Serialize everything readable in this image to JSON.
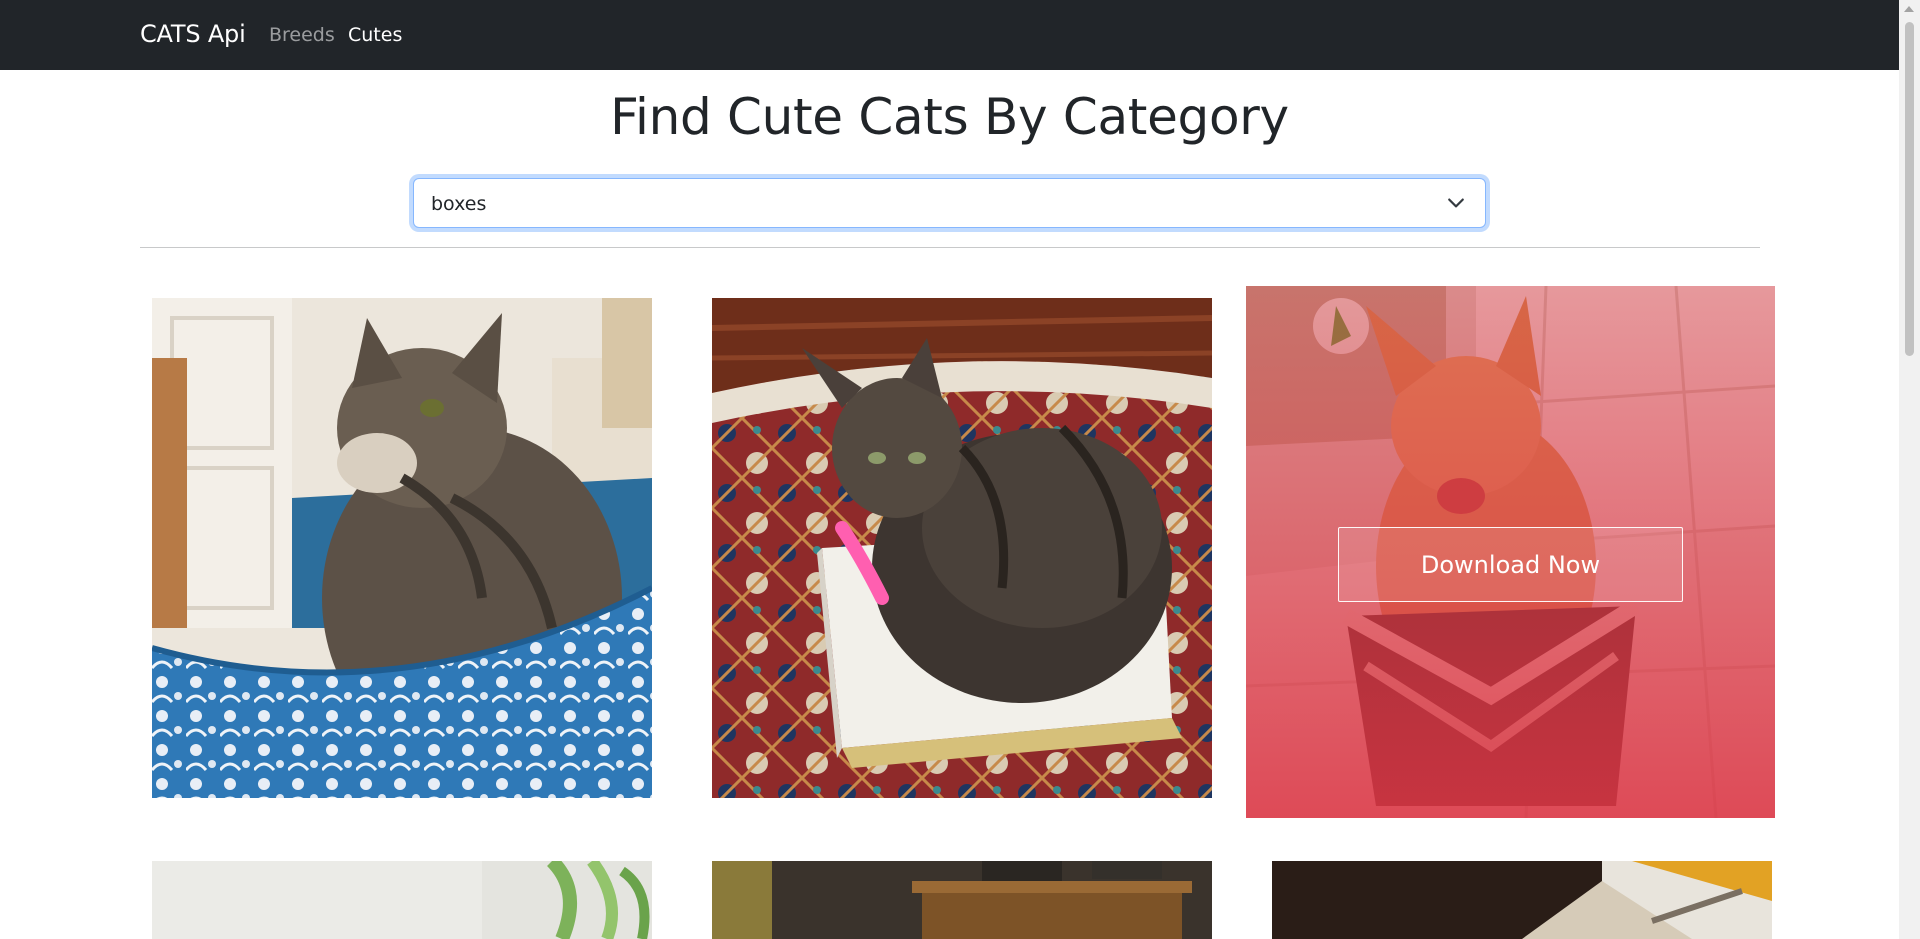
{
  "navbar": {
    "brand": "CATS Api",
    "links": [
      {
        "label": "Breeds",
        "active": false
      },
      {
        "label": "Cutes",
        "active": true
      }
    ]
  },
  "main": {
    "title": "Find Cute Cats By Category",
    "category_select": {
      "selected": "boxes"
    },
    "gallery": {
      "cards": [
        {
          "alt": "tabby cat in blue floral box"
        },
        {
          "alt": "long-haired cat in white box on rug"
        },
        {
          "alt": "orange cat in wicker basket",
          "hover_button": "Download Now"
        },
        {
          "alt": "cat photo"
        },
        {
          "alt": "cat photo"
        },
        {
          "alt": "cat photo"
        }
      ]
    }
  },
  "colors": {
    "navbar_bg": "#212529",
    "overlay": "#dc3545",
    "focus_ring": "#86b7fe"
  }
}
